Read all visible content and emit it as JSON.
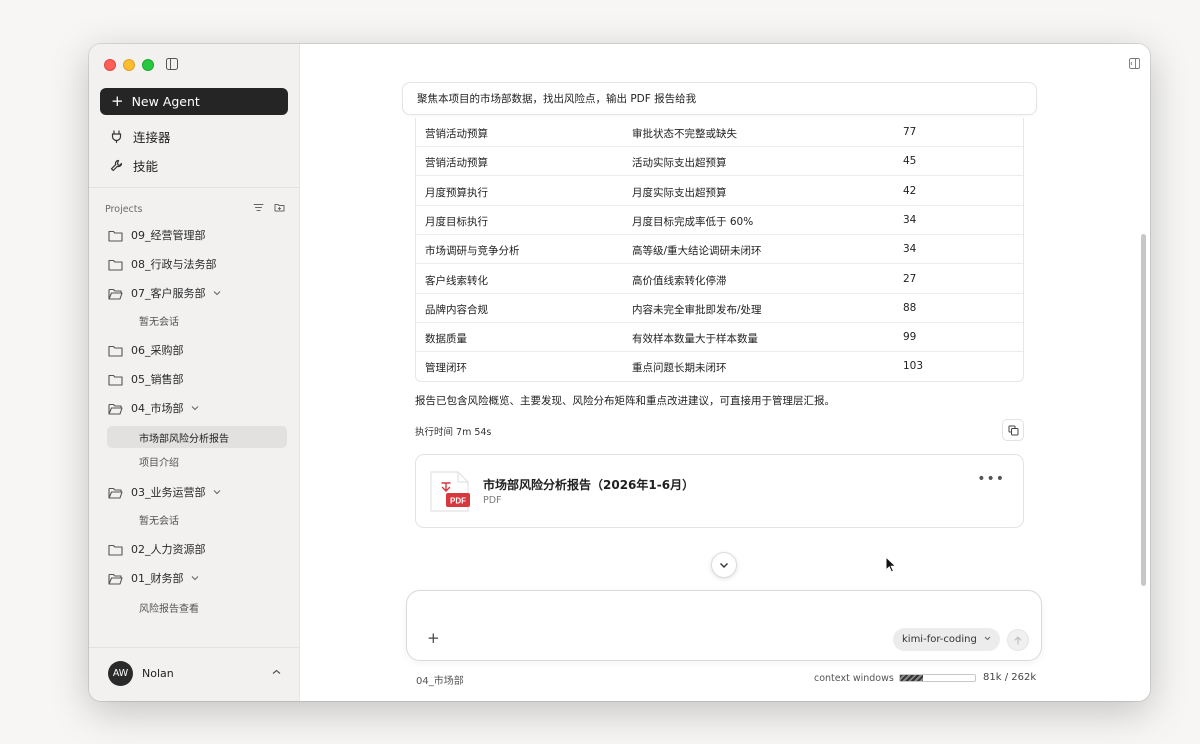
{
  "sidebar": {
    "new_agent_label": "New Agent",
    "nav": [
      {
        "label": "连接器",
        "icon": "plug-icon"
      },
      {
        "label": "技能",
        "icon": "wrench-icon"
      }
    ],
    "projects_label": "Projects",
    "projects": [
      {
        "name": "09_经营管理部",
        "expanded": false
      },
      {
        "name": "08_行政与法务部",
        "expanded": false
      },
      {
        "name": "07_客户服务部",
        "expanded": true,
        "children": [
          "暂无会话"
        ]
      },
      {
        "name": "06_采购部",
        "expanded": false
      },
      {
        "name": "05_销售部",
        "expanded": false
      },
      {
        "name": "04_市场部",
        "expanded": true,
        "children": [
          "市场部风险分析报告",
          "项目介绍"
        ],
        "active_child": 0
      },
      {
        "name": "03_业务运营部",
        "expanded": true,
        "children": [
          "暂无会话"
        ]
      },
      {
        "name": "02_人力资源部",
        "expanded": false
      },
      {
        "name": "01_财务部",
        "expanded": true,
        "children": [
          "风险报告查看"
        ]
      }
    ],
    "user": {
      "initials": "AW",
      "name": "Nolan"
    }
  },
  "chat": {
    "prompt": "聚焦本项目的市场部数据，找出风险点，输出 PDF 报告给我",
    "table_rows": [
      [
        "营销活动预算",
        "审批状态不完整或缺失",
        "77"
      ],
      [
        "营销活动预算",
        "活动实际支出超预算",
        "45"
      ],
      [
        "月度预算执行",
        "月度实际支出超预算",
        "42"
      ],
      [
        "月度目标执行",
        "月度目标完成率低于 60%",
        "34"
      ],
      [
        "市场调研与竞争分析",
        "高等级/重大结论调研未闭环",
        "34"
      ],
      [
        "客户线索转化",
        "高价值线索转化停滞",
        "27"
      ],
      [
        "品牌内容合规",
        "内容未完全审批即发布/处理",
        "88"
      ],
      [
        "数据质量",
        "有效样本数量大于样本数量",
        "99"
      ],
      [
        "管理闭环",
        "重点问题长期未闭环",
        "103"
      ]
    ],
    "summary": "报告已包含风险概览、主要发现、风险分布矩阵和重点改进建议，可直接用于管理层汇报。",
    "exec_time": "执行时间 7m 54s",
    "file": {
      "title": "市场部风险分析报告（2026年1-6月）",
      "type": "PDF",
      "badge": "PDF"
    }
  },
  "composer": {
    "placeholder": "",
    "model": "kimi-for-coding"
  },
  "footer": {
    "project": "04_市场部",
    "context_label": "context windows",
    "context_value": "81k / 262k",
    "context_fraction": 0.31
  },
  "colors": {
    "accent_dark": "#252525",
    "pdf_red": "#d7373f"
  }
}
